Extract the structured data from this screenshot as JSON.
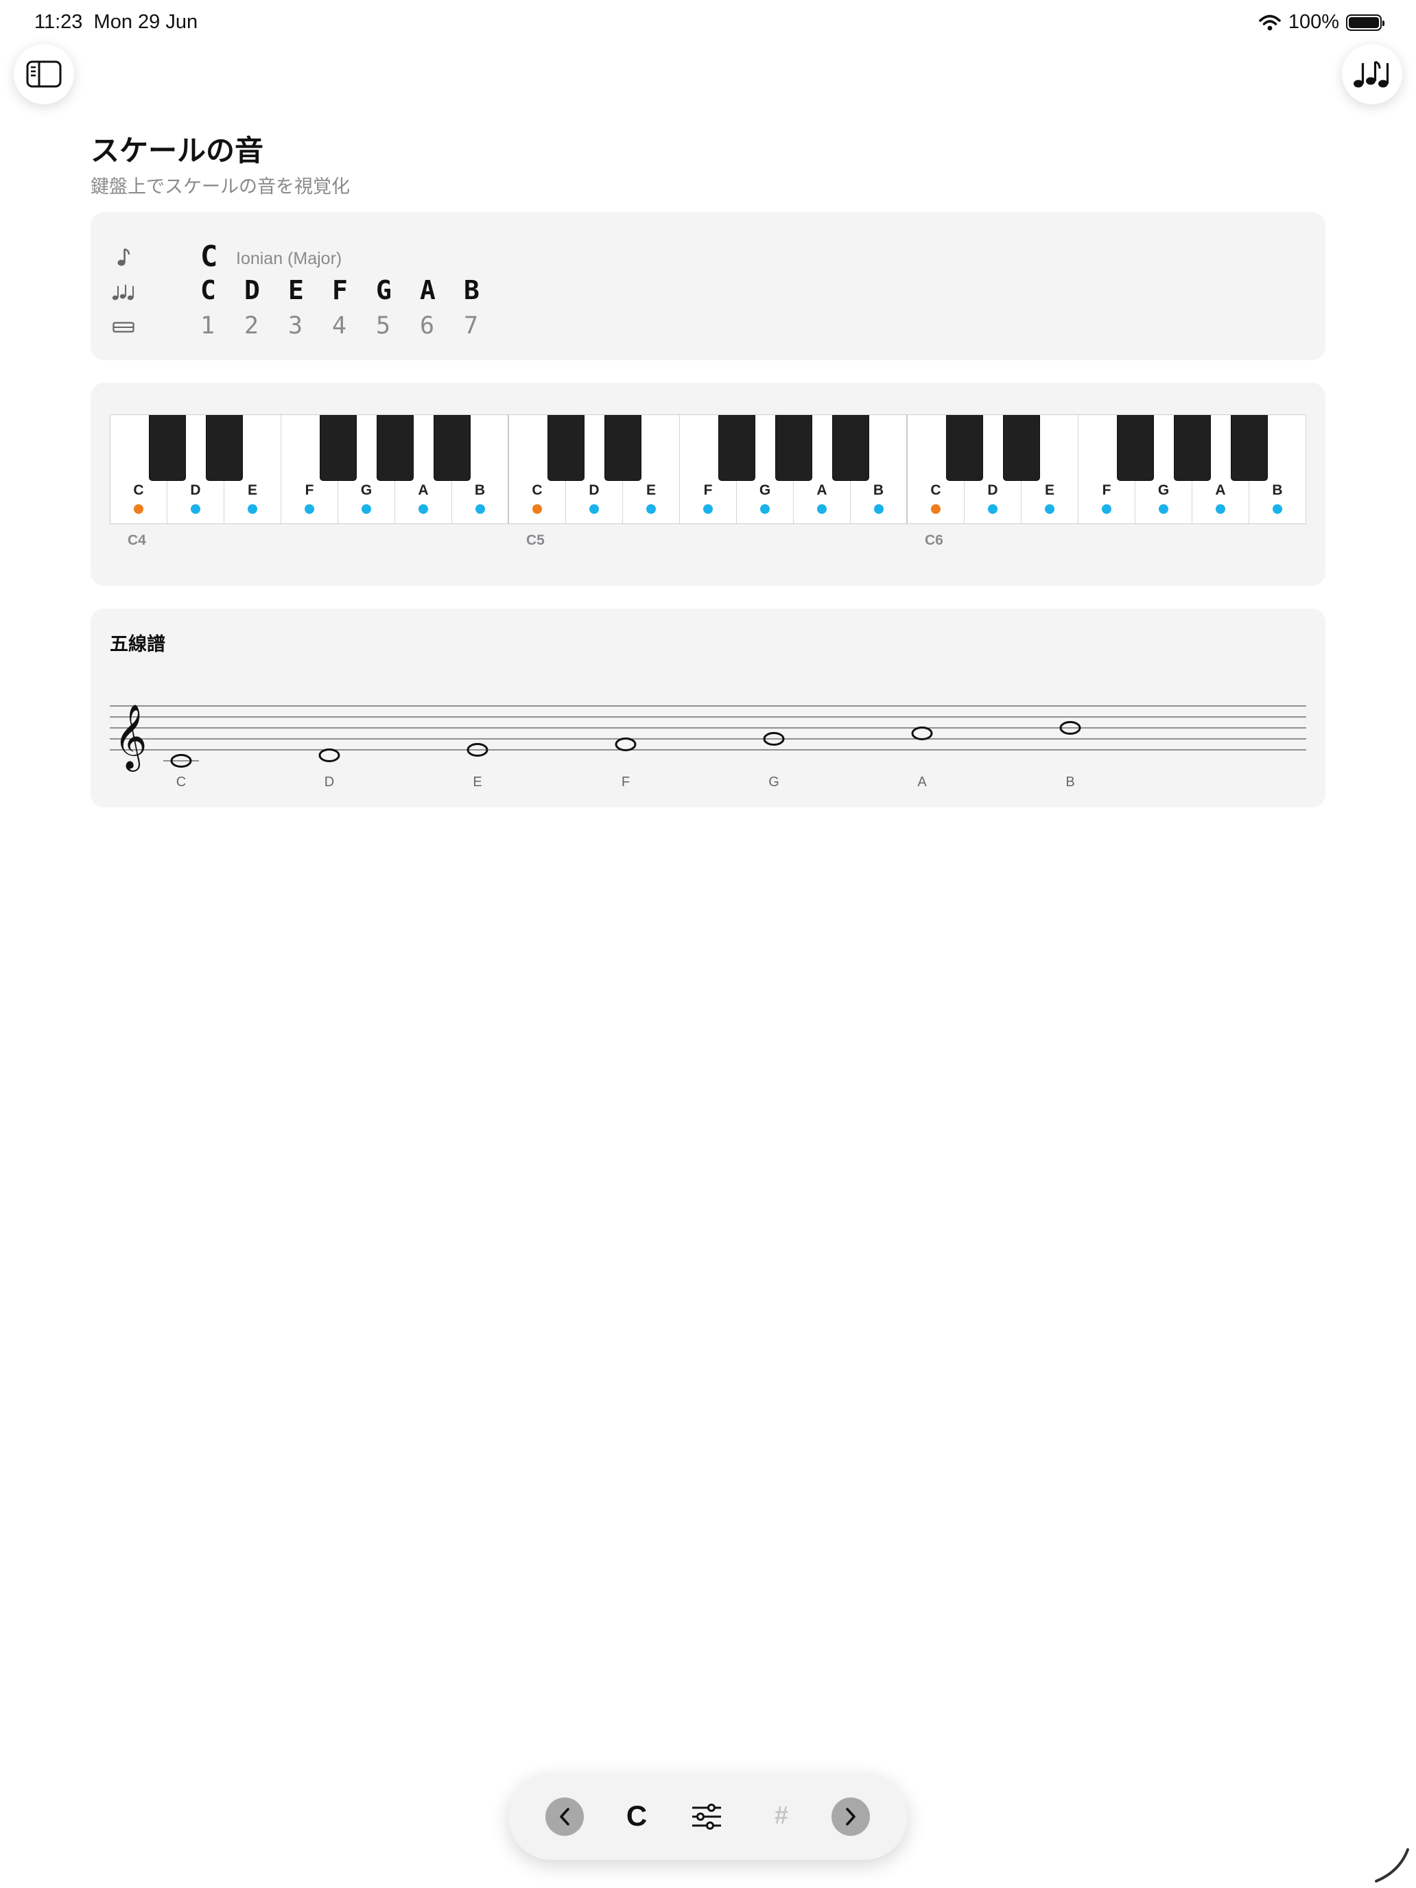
{
  "status_bar": {
    "time": "11:23",
    "date": "Mon 29 Jun",
    "battery": "100%",
    "wifi_icon": "wifi-icon",
    "battery_icon": "battery-icon"
  },
  "toolbar": {
    "sidebar_button_icon": "sidebar-icon",
    "scales_button_icon": "music-notes-icon"
  },
  "header": {
    "title": "スケールの音",
    "subtitle": "鍵盤上でスケールの音を視覚化"
  },
  "scale_info": {
    "key": "C",
    "mode": "Ionian (Major)",
    "notes": [
      "C",
      "D",
      "E",
      "F",
      "G",
      "A",
      "B"
    ],
    "degrees": [
      "1",
      "2",
      "3",
      "4",
      "5",
      "6",
      "7"
    ],
    "icons": [
      "music-note-icon",
      "music-notes-icon",
      "keyboard-icon"
    ]
  },
  "keyboard": {
    "octaves": [
      "C4",
      "C5",
      "C6"
    ],
    "white_keys": [
      "C",
      "D",
      "E",
      "F",
      "G",
      "A",
      "B",
      "C",
      "D",
      "E",
      "F",
      "G",
      "A",
      "B",
      "C",
      "D",
      "E",
      "F",
      "G",
      "A",
      "B"
    ],
    "root_note": "C",
    "scale_notes": [
      "C",
      "D",
      "E",
      "F",
      "G",
      "A",
      "B"
    ],
    "colors": {
      "root": "#f07d19",
      "scale": "#1ab2ea"
    }
  },
  "staff": {
    "title": "五線譜",
    "clef": "𝄞",
    "notes": [
      "C",
      "D",
      "E",
      "F",
      "G",
      "A",
      "B"
    ]
  },
  "bottom_bar": {
    "key": "C",
    "sharp": "#",
    "prev_icon": "chevron-left-icon",
    "next_icon": "chevron-right-icon",
    "settings_icon": "sliders-icon"
  }
}
